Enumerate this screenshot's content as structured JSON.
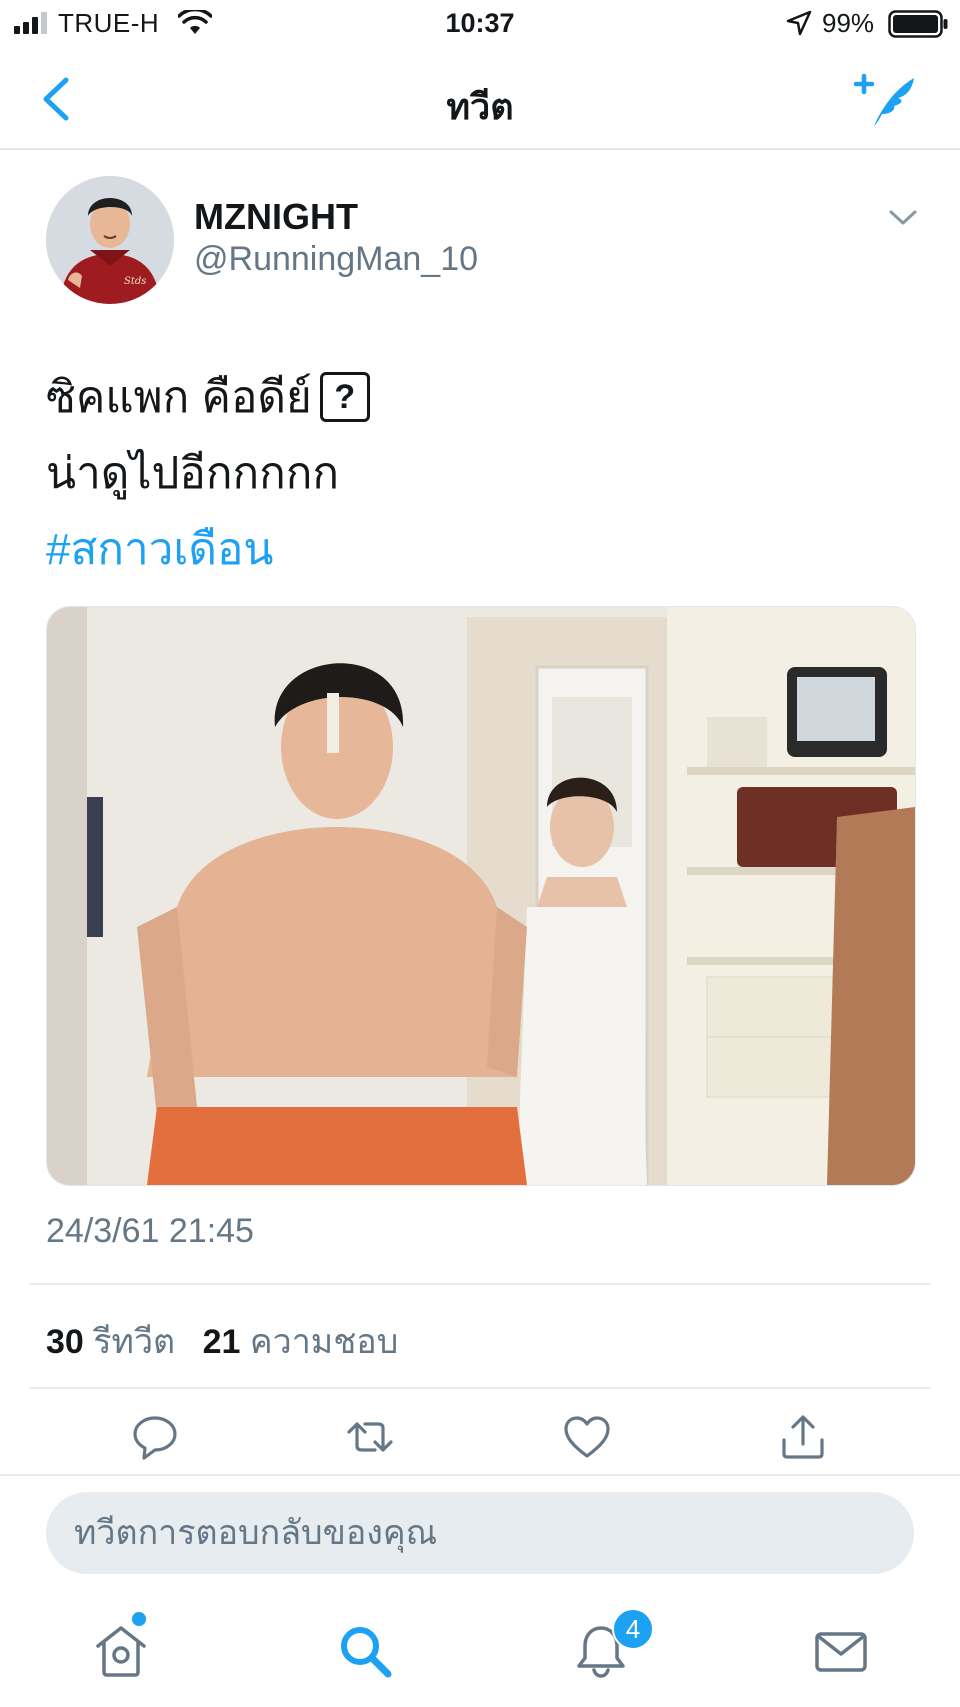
{
  "status_bar": {
    "carrier": "TRUE-H",
    "time": "10:37",
    "battery": "99%"
  },
  "nav": {
    "title": "ทวีต"
  },
  "tweet": {
    "author_name": "MZNIGHT",
    "author_handle": "@RunningMan_10",
    "text_line1": "ซิคแพก คือดีย์",
    "emoji_box": "?",
    "text_line2": "น่าดูไปอีกกกกก",
    "hashtag": "#สกาวเดือน",
    "timestamp": "24/3/61 21:45",
    "retweet_count": "30",
    "retweet_label": "รีทวีต",
    "like_count": "21",
    "like_label": "ความชอบ"
  },
  "reply": {
    "placeholder": "ทวีตการตอบกลับของคุณ"
  },
  "tabbar": {
    "notification_badge": "4"
  },
  "colors": {
    "accent": "#1da1f2",
    "secondary_text": "#657786",
    "divider": "#e6ecf0"
  }
}
